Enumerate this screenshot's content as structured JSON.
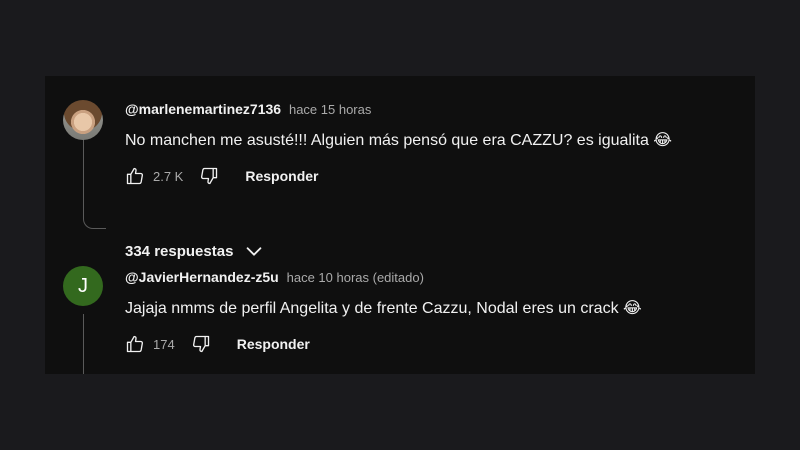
{
  "comments": [
    {
      "author": "@marlenemartinez7136",
      "time": "hace 15 horas",
      "text": "No manchen me asusté!!! Alguien más pensó que era CAZZU? es igualita",
      "emoji": "😂",
      "likes": "2.7 K",
      "reply_label": "Responder",
      "replies_label": "334 respuestas"
    },
    {
      "author": "@JavierHernandez-z5u",
      "time": "hace 10 horas (editado)",
      "avatar_letter": "J",
      "text": "Jajaja nmms de perfil Angelita y de frente Cazzu, Nodal eres un crack",
      "emoji": "😂",
      "likes": "174",
      "reply_label": "Responder"
    }
  ],
  "colors": {
    "background": "#0f0f0f",
    "avatar_green": "#33691e",
    "meta_text": "#aaaaaa"
  },
  "icons": [
    "thumbs-up-icon",
    "thumbs-down-icon",
    "chevron-down-icon"
  ]
}
